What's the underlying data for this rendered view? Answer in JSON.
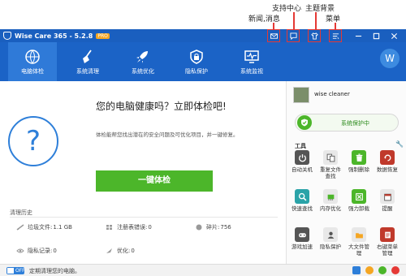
{
  "annotations": {
    "news": "新闻,消息",
    "support": "支持中心",
    "theme": "主题背景",
    "menu": "菜单"
  },
  "window": {
    "title": "Wise Care 365 - 5.2.8",
    "badge": "PRO"
  },
  "nav": {
    "items": [
      {
        "label": "电脑体检",
        "icon": "globe-check-icon",
        "active": true
      },
      {
        "label": "系统清理",
        "icon": "broom-icon"
      },
      {
        "label": "系统优化",
        "icon": "rocket-icon"
      },
      {
        "label": "隐私保护",
        "icon": "lock-icon"
      },
      {
        "label": "系统监视",
        "icon": "monitor-icon"
      }
    ],
    "avatar_letter": "W"
  },
  "main": {
    "headline": "您的电脑健康吗？立即体检吧!",
    "subtext": "体检能帮您找出潜在的安全问题及可优化项目，并一键修复。",
    "scan_button": "一键体检",
    "question_mark": "?",
    "history_title": "清理历史",
    "stats": {
      "junk": {
        "label": "垃圾文件:",
        "value": "1.1 GB"
      },
      "registry": {
        "label": "注册表错误:",
        "value": "0"
      },
      "fragment": {
        "label": "碎片:",
        "value": "756"
      },
      "privacy": {
        "label": "隐私记录:",
        "value": "0"
      },
      "optimize": {
        "label": "优化:",
        "value": "0"
      }
    }
  },
  "sidebar": {
    "user": "wise cleaner",
    "protection": "系统保护中",
    "tools_title": "工具",
    "tools": [
      {
        "label": "自动关机",
        "icon": "power-icon",
        "color": "#555555"
      },
      {
        "label": "重复文件\n查找",
        "icon": "duplicate-file-icon",
        "color": "#e8e8e8"
      },
      {
        "label": "强制删除",
        "icon": "trash-icon",
        "color": "#4cb62a"
      },
      {
        "label": "数据恢复",
        "icon": "data-recovery-icon",
        "color": "#c0392b"
      },
      {
        "label": "快速查找",
        "icon": "search-icon",
        "color": "#2aa3a8"
      },
      {
        "label": "内存优化",
        "icon": "memory-icon",
        "color": "#e8e8e8"
      },
      {
        "label": "强力卸载",
        "icon": "uninstall-icon",
        "color": "#4cb62a"
      },
      {
        "label": "提醒",
        "icon": "reminder-icon",
        "color": "#e8e8e8"
      },
      {
        "label": "游戏加速",
        "icon": "gamepad-icon",
        "color": "#555555"
      },
      {
        "label": "隐私保护",
        "icon": "privacy-icon",
        "color": "#e8e8e8"
      },
      {
        "label": "大文件管\n理",
        "icon": "large-file-icon",
        "color": "#e8e8e8"
      },
      {
        "label": "右键菜单\n管理",
        "icon": "context-menu-icon",
        "color": "#c0392b"
      }
    ]
  },
  "statusbar": {
    "toggle_state": "OFF",
    "schedule_text": "定期清理您的电脑。"
  },
  "colors": {
    "titlebar": "#1a5fbf",
    "navbar": "#1b63c6",
    "accent": "#2e7fd9",
    "scan_button": "#4cb62a",
    "annotation": "#e53935"
  }
}
